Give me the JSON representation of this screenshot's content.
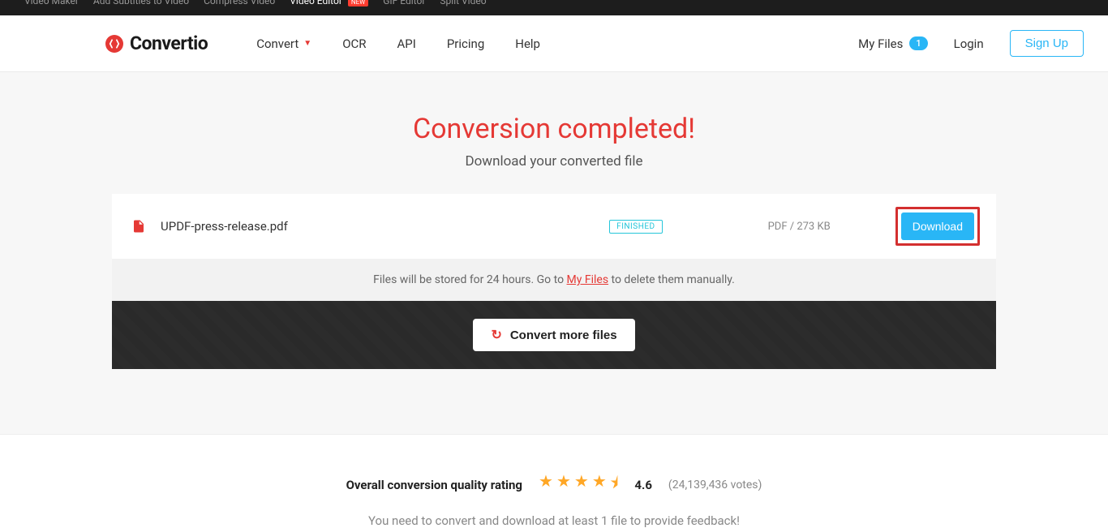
{
  "topbar": {
    "items": [
      "Video Maker",
      "Add Subtitles to Video",
      "Compress Video",
      "Video Editor",
      "GIF Editor",
      "Split Video"
    ],
    "new_badge": "NEW"
  },
  "header": {
    "logo": "Convertio",
    "nav": [
      "Convert",
      "OCR",
      "API",
      "Pricing",
      "Help"
    ],
    "myfiles_label": "My Files",
    "myfiles_count": "1",
    "login": "Login",
    "signup": "Sign Up"
  },
  "main": {
    "heading": "Conversion completed!",
    "subheading": "Download your converted file"
  },
  "file": {
    "name": "UPDF-press-release.pdf",
    "status": "FINISHED",
    "meta": "PDF / 273 KB",
    "download_label": "Download"
  },
  "storage": {
    "prefix": "Files will be stored for 24 hours. Go to ",
    "link": "My Files",
    "suffix": " to delete them manually."
  },
  "convert_more": "Convert more files",
  "rating": {
    "label": "Overall conversion quality rating",
    "score": "4.6",
    "count": "(24,139,436 votes)",
    "subtext": "You need to convert and download at least 1 file to provide feedback!"
  }
}
